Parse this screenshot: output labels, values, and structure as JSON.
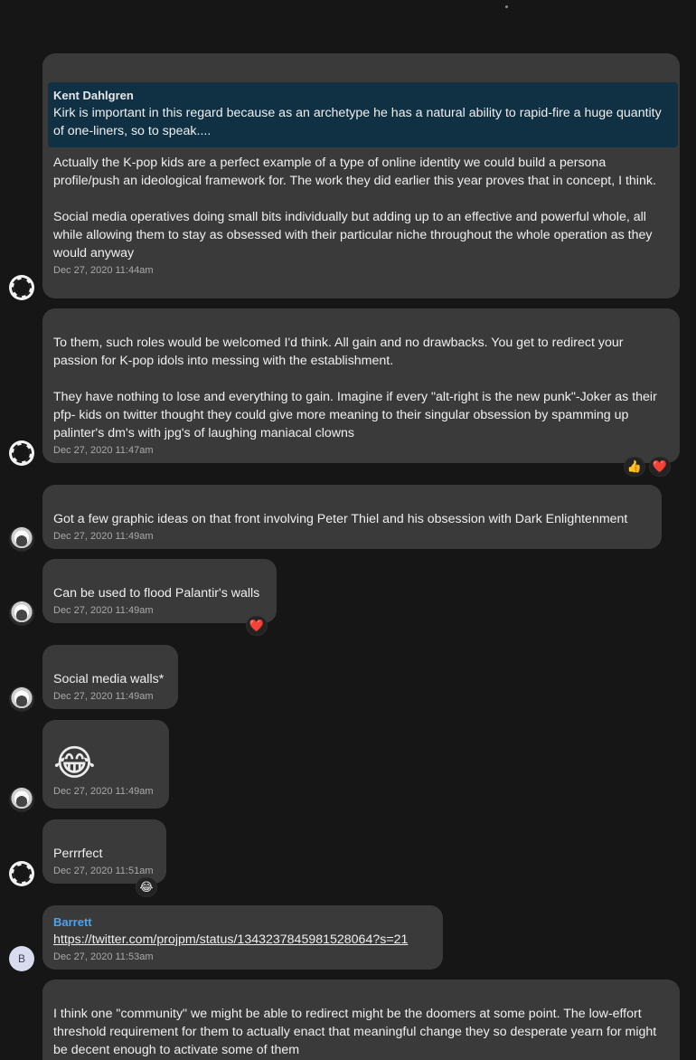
{
  "messages": [
    {
      "quote": {
        "author": "Kent Dahlgren",
        "text": "Kirk is important in this regard because as an archetype he has a natural ability to rapid-fire a huge quantity of one-liners, so to speak...."
      },
      "text": "Actually the K-pop kids are a perfect example of a type of online identity we could build a persona profile/push an ideological framework for. The work they did earlier this year proves that in concept, I think.\n\nSocial media operatives doing small bits individually but adding up to an effective and powerful whole, all while allowing them to stay as obsessed with their particular niche throughout the whole operation as they would anyway",
      "timestamp": "Dec 27, 2020 11:44am",
      "avatar": "ring-avatar"
    },
    {
      "text": "To them, such roles would be welcomed I'd think. All gain and no drawbacks. You get to redirect your passion for K-pop idols into messing with the establishment.\n\nThey have nothing to lose and everything to gain. Imagine if every \"alt-right is the new punk\"-Joker as their pfp- kids on twitter thought they could give more meaning to their singular obsession by spamming up palinter's dm's with jpg's of laughing maniacal clowns",
      "timestamp": "Dec 27, 2020 11:47am",
      "avatar": "ring-avatar",
      "reactions": [
        "👍",
        "❤️"
      ]
    },
    {
      "text": "Got a few graphic ideas on that front involving Peter Thiel and his obsession with Dark Enlightenment",
      "timestamp": "Dec 27, 2020 11:49am",
      "avatar": "mask-avatar"
    },
    {
      "text": "Can be used to flood Palantir's walls",
      "timestamp": "Dec 27, 2020 11:49am",
      "avatar": "mask-avatar",
      "reactions": [
        "❤️"
      ]
    },
    {
      "text": "Social media walls*",
      "timestamp": "Dec 27, 2020 11:49am",
      "avatar": "mask-avatar"
    },
    {
      "emoji": "😂",
      "timestamp": "Dec 27, 2020 11:49am",
      "avatar": "mask-avatar"
    },
    {
      "text": "Perrrfect",
      "timestamp": "Dec 27, 2020 11:51am",
      "avatar": "ring-avatar",
      "reactions": [
        "😂"
      ]
    },
    {
      "sender": "Barrett",
      "link": "https://twitter.com/projpm/status/1343237845981528064?s=21",
      "timestamp": "Dec 27, 2020 11:53am",
      "avatar_letter": "B"
    },
    {
      "text": "I think one \"community\" we might be able to redirect might be the doomers at some point. The low-effort threshold requirement for them to actually enact that meaningful change they so desperate yearn for might be decent enough to activate some of them"
    }
  ],
  "colors": {
    "background": "#161616",
    "bubble": "#3a3a3a",
    "quote_background": "#103044",
    "sender_name": "#4aa3f0",
    "timestamp": "#a9a9a9"
  }
}
